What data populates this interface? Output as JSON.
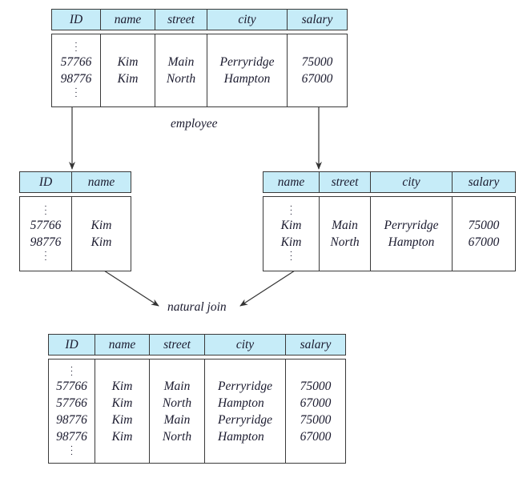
{
  "diagram": {
    "employee": {
      "label": "employee",
      "headers": [
        "ID",
        "name",
        "street",
        "city",
        "salary"
      ],
      "columns": [
        [
          "57766",
          "98776"
        ],
        [
          "Kim",
          "Kim"
        ],
        [
          "Main",
          "North"
        ],
        [
          "Perryridge",
          "Hampton"
        ],
        [
          "75000",
          "67000"
        ]
      ]
    },
    "left_projection": {
      "headers": [
        "ID",
        "name"
      ],
      "columns": [
        [
          "57766",
          "98776"
        ],
        [
          "Kim",
          "Kim"
        ]
      ]
    },
    "right_projection": {
      "headers": [
        "name",
        "street",
        "city",
        "salary"
      ],
      "columns": [
        [
          "Kim",
          "Kim"
        ],
        [
          "Main",
          "North"
        ],
        [
          "Perryridge",
          "Hampton"
        ],
        [
          "75000",
          "67000"
        ]
      ]
    },
    "operation_label": "natural join",
    "result": {
      "headers": [
        "ID",
        "name",
        "street",
        "city",
        "salary"
      ],
      "columns": [
        [
          "57766",
          "57766",
          "98776",
          "98776"
        ],
        [
          "Kim",
          "Kim",
          "Kim",
          "Kim"
        ],
        [
          "Main",
          "North",
          "Main",
          "North"
        ],
        [
          "Perryridge",
          "Hampton",
          "Perryridge",
          "Hampton"
        ],
        [
          "75000",
          "67000",
          "75000",
          "67000"
        ]
      ]
    },
    "ellipsis": "⋮",
    "colors": {
      "header_fill": "#c6ecf8",
      "border": "#3a3a3a"
    }
  }
}
